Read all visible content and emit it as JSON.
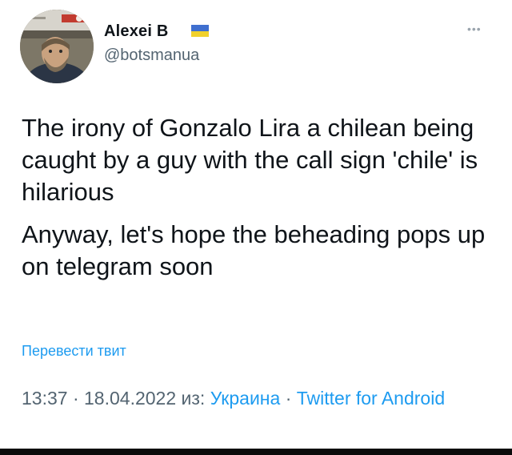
{
  "tweet": {
    "author": {
      "name": "Alexei B",
      "handle": "@botsmanua",
      "flag": "ukraine-flag-icon"
    },
    "more_icon": "more-icon",
    "paragraphs": [
      "The irony of Gonzalo Lira a chilean being caught by a guy with the call sign 'chile' is hilarious",
      "Anyway, let's hope the beheading pops up on telegram soon"
    ],
    "translate_label": "Перевести твит",
    "meta": {
      "time": "13:37",
      "date": "18.04.2022",
      "from_label": "из:",
      "location": "Украина",
      "source": "Twitter for Android",
      "separator": "·"
    }
  },
  "colors": {
    "link": "#1d9bf0",
    "secondary": "#536471",
    "flag_blue": "#3f6fcf",
    "flag_yellow": "#f1d12b"
  }
}
